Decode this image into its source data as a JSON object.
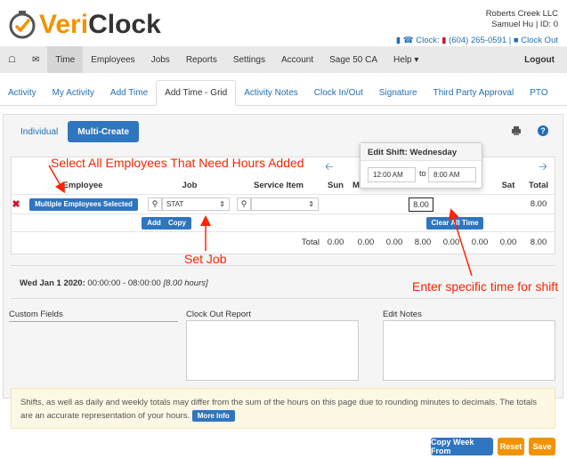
{
  "brand": {
    "part1": "Veri",
    "part2": "Clock"
  },
  "account": {
    "company": "Roberts Creek LLC",
    "user": "Samuel Hu | ID: 0",
    "clock_label": "Clock:",
    "phone": "(604) 265-0591",
    "clock_out": "Clock Out"
  },
  "topnav": {
    "items": [
      "Time",
      "Employees",
      "Jobs",
      "Reports",
      "Settings",
      "Account",
      "Sage 50 CA",
      "Help"
    ],
    "logout": "Logout"
  },
  "subnav": {
    "tabs": [
      "Activity",
      "My Activity",
      "Add Time",
      "Add Time - Grid",
      "Activity Notes",
      "Clock In/Out",
      "Signature",
      "Third Party Approval",
      "PTO"
    ]
  },
  "modes": {
    "individual": "Individual",
    "multi": "Multi-Create"
  },
  "grid": {
    "headers": {
      "employee": "Employee",
      "job": "Job",
      "service": "Service Item",
      "sun": "Sun",
      "mon": "M",
      "sat": "Sat",
      "total": "Total"
    },
    "employee_btn": "Multiple Employees Selected",
    "job_value": "STAT",
    "day_value": "8.00",
    "row_total": "8.00",
    "add": "Add",
    "copy": "Copy",
    "clear": "Clear All Time",
    "total_label": "Total",
    "totals": [
      "0.00",
      "0.00",
      "0.00",
      "8.00",
      "0.00",
      "0.00",
      "0.00",
      "8.00"
    ]
  },
  "popup": {
    "title": "Edit Shift: Wednesday",
    "from": "12:00 AM",
    "to_label": "to",
    "to": "8:00 AM"
  },
  "shift": {
    "date": "Wed Jan 1 2020:",
    "range": "00:00:00 - 08:00:00",
    "hours": "[8.00 hours]"
  },
  "fields": {
    "custom": "Custom Fields",
    "clockout": "Clock Out Report",
    "notes": "Edit Notes"
  },
  "notice": {
    "text": "Shifts, as well as daily and weekly totals may differ from the sum of the hours on this page due to rounding minutes to decimals. The totals are an accurate representation of your hours.",
    "more": "More Info"
  },
  "actions": {
    "copy_week": "Copy Week From",
    "reset": "Reset",
    "save": "Save"
  },
  "annotations": {
    "a1": "Select All Employees That Need Hours Added",
    "a2": "Set Job",
    "a3": "Enter specific time for shift"
  },
  "colors": {
    "primary": "#2f75c0",
    "orange": "#f39200",
    "annotation": "#ff2200"
  }
}
